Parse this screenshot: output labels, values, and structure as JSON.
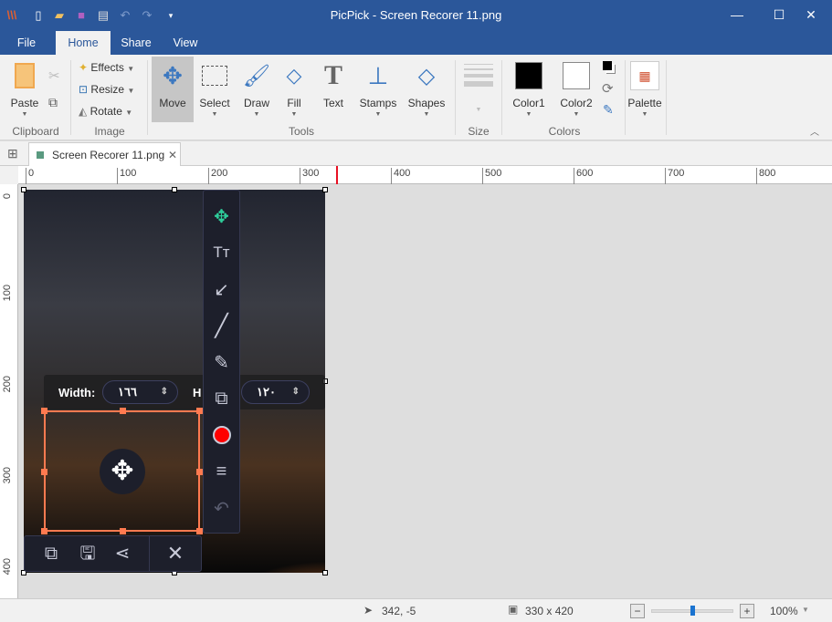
{
  "window": {
    "title": "PicPick - Screen Recorer 11.png"
  },
  "quick_access": [
    "app-logo-icon",
    "new-icon",
    "open-icon",
    "save-icon",
    "print-icon",
    "undo-icon",
    "redo-icon",
    "customize-icon"
  ],
  "ribbon_tabs": [
    {
      "label": "File"
    },
    {
      "label": "Home",
      "active": true
    },
    {
      "label": "Share"
    },
    {
      "label": "View"
    }
  ],
  "ribbon": {
    "clipboard": {
      "paste": "Paste",
      "group": "Clipboard"
    },
    "image": {
      "effects": "Effects",
      "resize": "Resize",
      "rotate": "Rotate",
      "group": "Image"
    },
    "tools": {
      "move": "Move",
      "select": "Select",
      "draw": "Draw",
      "fill": "Fill",
      "text": "Text",
      "stamps": "Stamps",
      "shapes": "Shapes",
      "group": "Tools"
    },
    "size": {
      "group": "Size"
    },
    "colors": {
      "color1": "Color1",
      "color2": "Color2",
      "group": "Colors",
      "color1_value": "#000000",
      "color2_value": "#ffffff"
    },
    "palette": {
      "label": "Palette"
    }
  },
  "document_tab": {
    "label": "Screen Recorer 11.png"
  },
  "ruler": {
    "h_labels": [
      "0",
      "100",
      "200",
      "300",
      "400",
      "500",
      "600",
      "700",
      "800"
    ],
    "v_labels": [
      "0",
      "100",
      "200",
      "300",
      "400"
    ],
    "marker_color": "#e81123"
  },
  "overlay": {
    "width_label": "Width:",
    "width_value": "١٦٦",
    "height_label": "H",
    "height_value": "١٢٠",
    "selection_color": "#ff7a50",
    "record_color": "#ff0000",
    "move_color": "#2ecc9a"
  },
  "status": {
    "cursor": "342, -5",
    "image_size": "330 x 420",
    "zoom": "100%",
    "zoom_level": 0.5
  }
}
